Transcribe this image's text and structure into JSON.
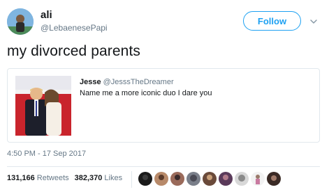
{
  "tweet": {
    "author": {
      "name": "ali",
      "handle": "@LebaenesePapi"
    },
    "follow_label": "Follow",
    "text": "my divorced parents",
    "timestamp": "4:50 PM - 17 Sep 2017",
    "stats": {
      "retweets_count": "131,166",
      "retweets_label": "Retweets",
      "likes_count": "382,370",
      "likes_label": "Likes"
    }
  },
  "quote": {
    "name": "Jesse",
    "handle": "@JesssTheDreamer",
    "text": "Name me a more iconic duo I dare you"
  },
  "colors": {
    "accent": "#1da1f2",
    "text": "#14171a",
    "muted": "#657786",
    "border": "#e1e8ed"
  }
}
